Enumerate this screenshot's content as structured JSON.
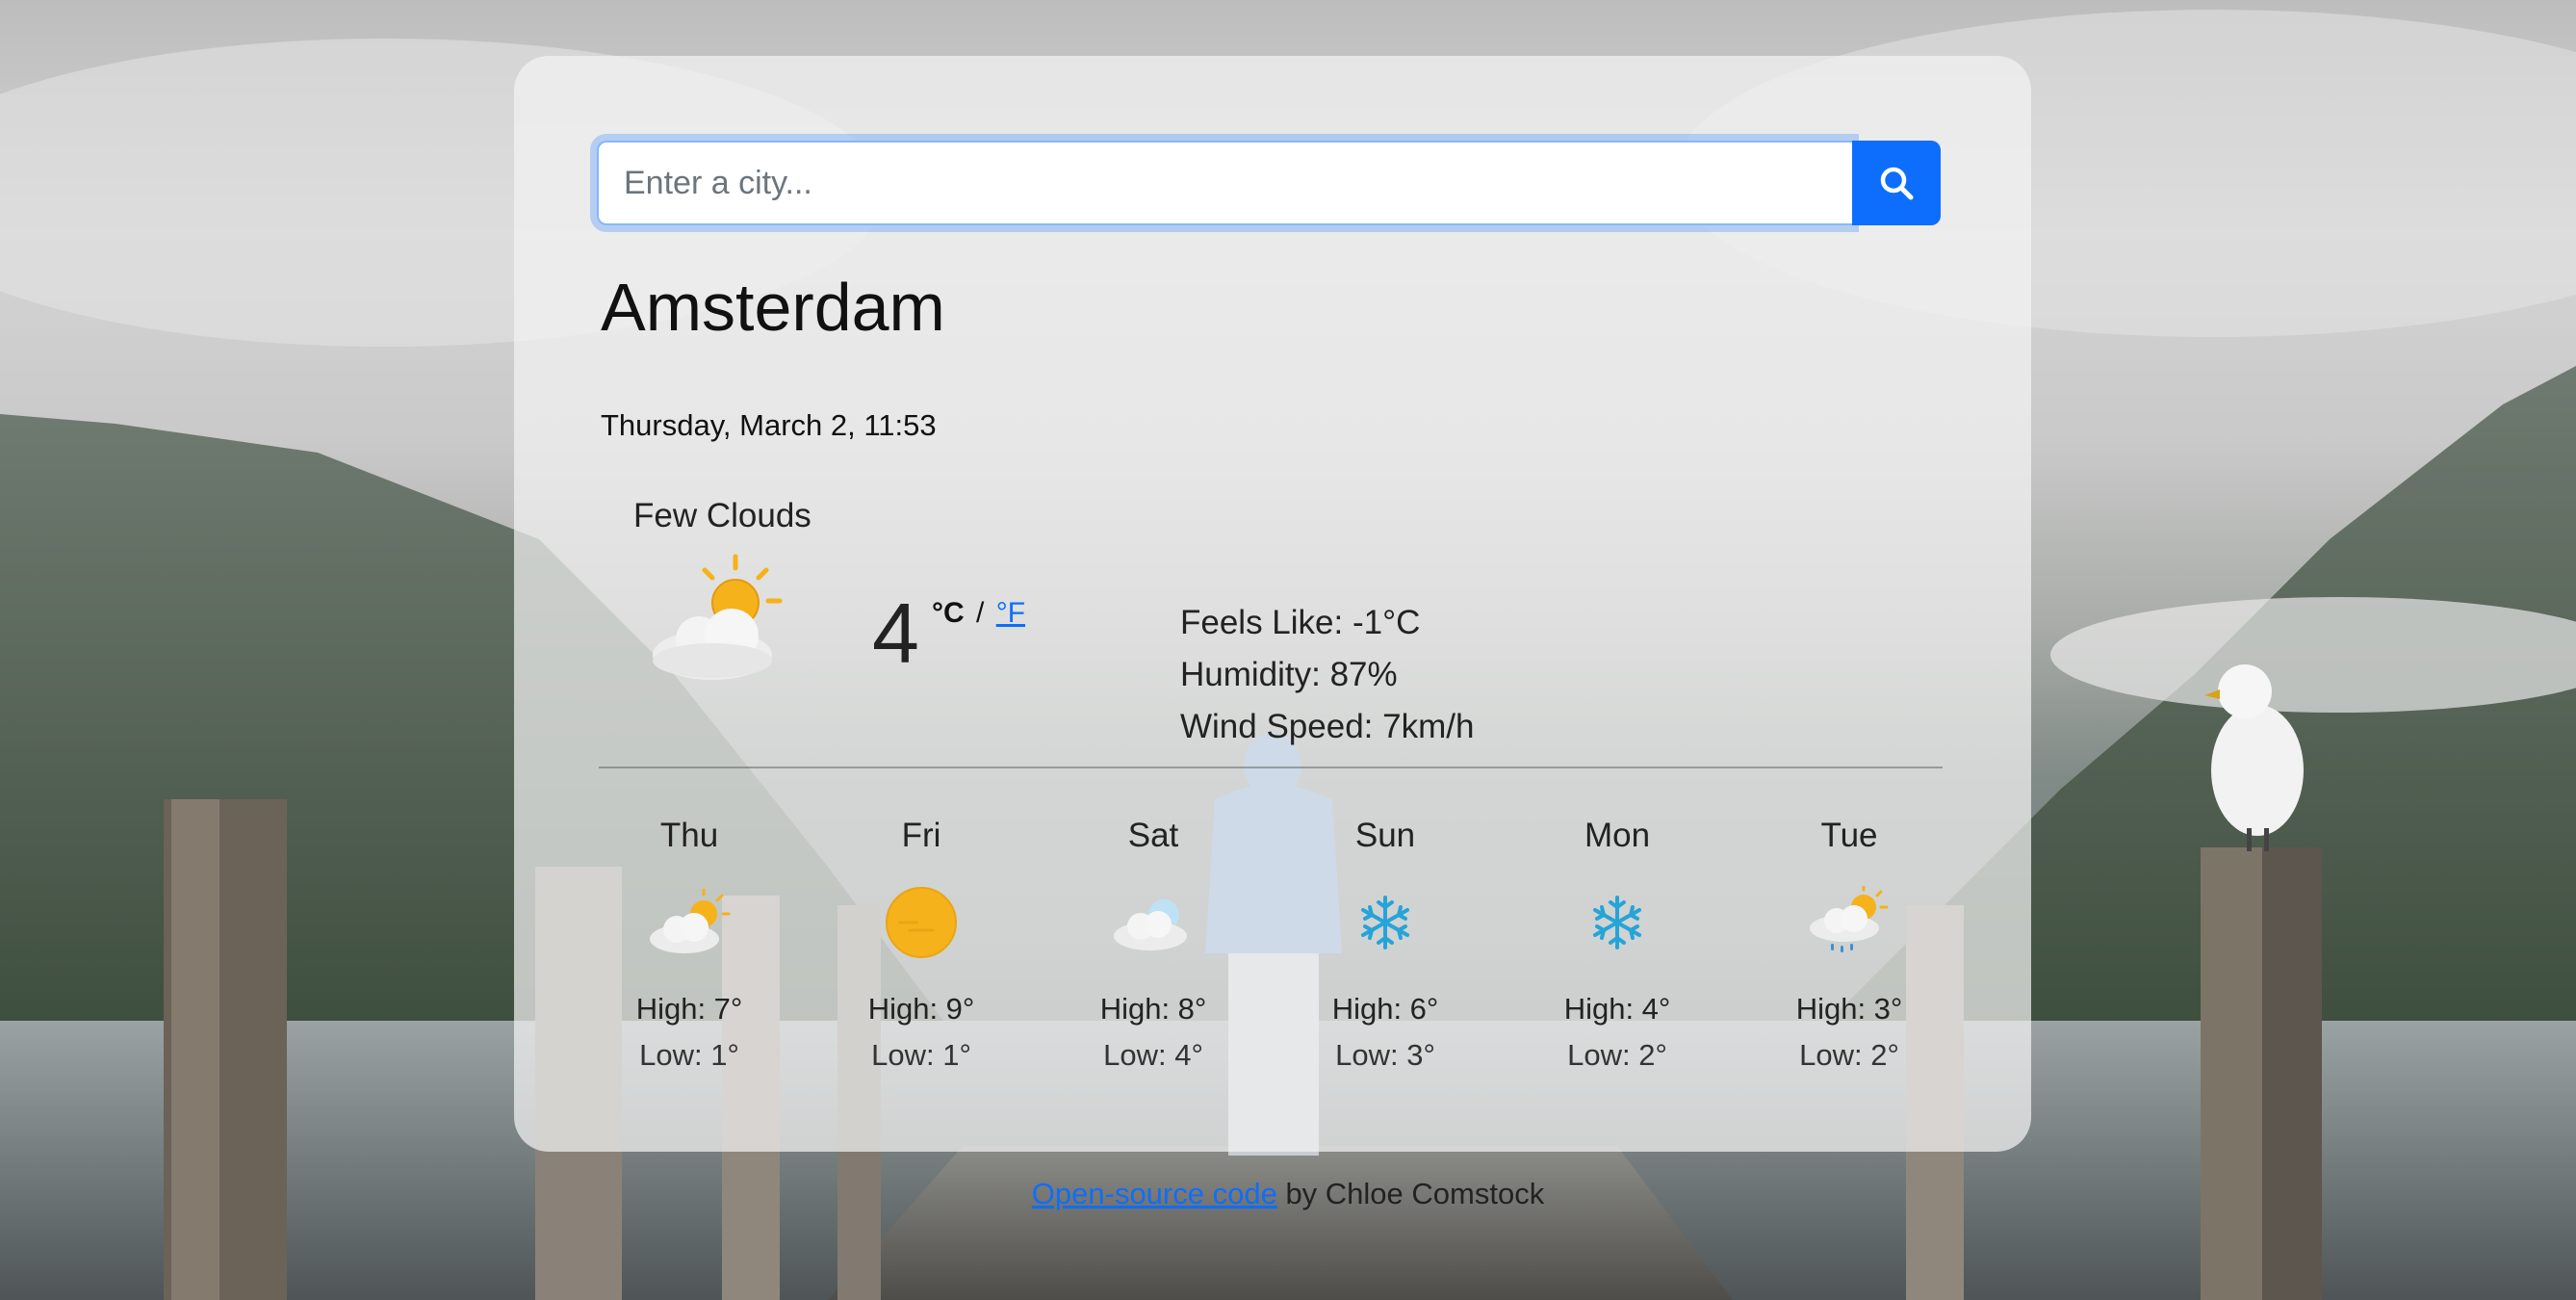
{
  "search": {
    "placeholder": "Enter a city...",
    "value": ""
  },
  "current": {
    "city": "Amsterdam",
    "datetime": "Thursday, March 2, 11:53",
    "description": "Few Clouds",
    "icon": "few-clouds-icon",
    "temperature": "4",
    "unit_celsius": "°C",
    "unit_separator": "/",
    "unit_fahrenheit": "°F",
    "feels_like": "Feels Like: -1°C",
    "humidity": "Humidity: 87%",
    "wind_speed": "Wind Speed: 7km/h"
  },
  "forecast": [
    {
      "day": "Thu",
      "icon": "few-clouds-icon",
      "high": "High: 7°",
      "low": "Low: 1°"
    },
    {
      "day": "Fri",
      "icon": "haze-sun-icon",
      "high": "High: 9°",
      "low": "Low: 1°"
    },
    {
      "day": "Sat",
      "icon": "clouds-icon",
      "high": "High: 8°",
      "low": "Low: 4°"
    },
    {
      "day": "Sun",
      "icon": "snowflake-icon",
      "high": "High: 6°",
      "low": "Low: 3°"
    },
    {
      "day": "Mon",
      "icon": "snowflake-icon",
      "high": "High: 4°",
      "low": "Low: 2°"
    },
    {
      "day": "Tue",
      "icon": "rain-sun-icon",
      "high": "High: 3°",
      "low": "Low: 2°"
    }
  ],
  "footer": {
    "link_text": "Open-source code",
    "suffix": " by Chloe Comstock"
  },
  "colors": {
    "accent": "#0d6efd",
    "sun": "#f5b21b",
    "snow": "#26a4d8"
  }
}
